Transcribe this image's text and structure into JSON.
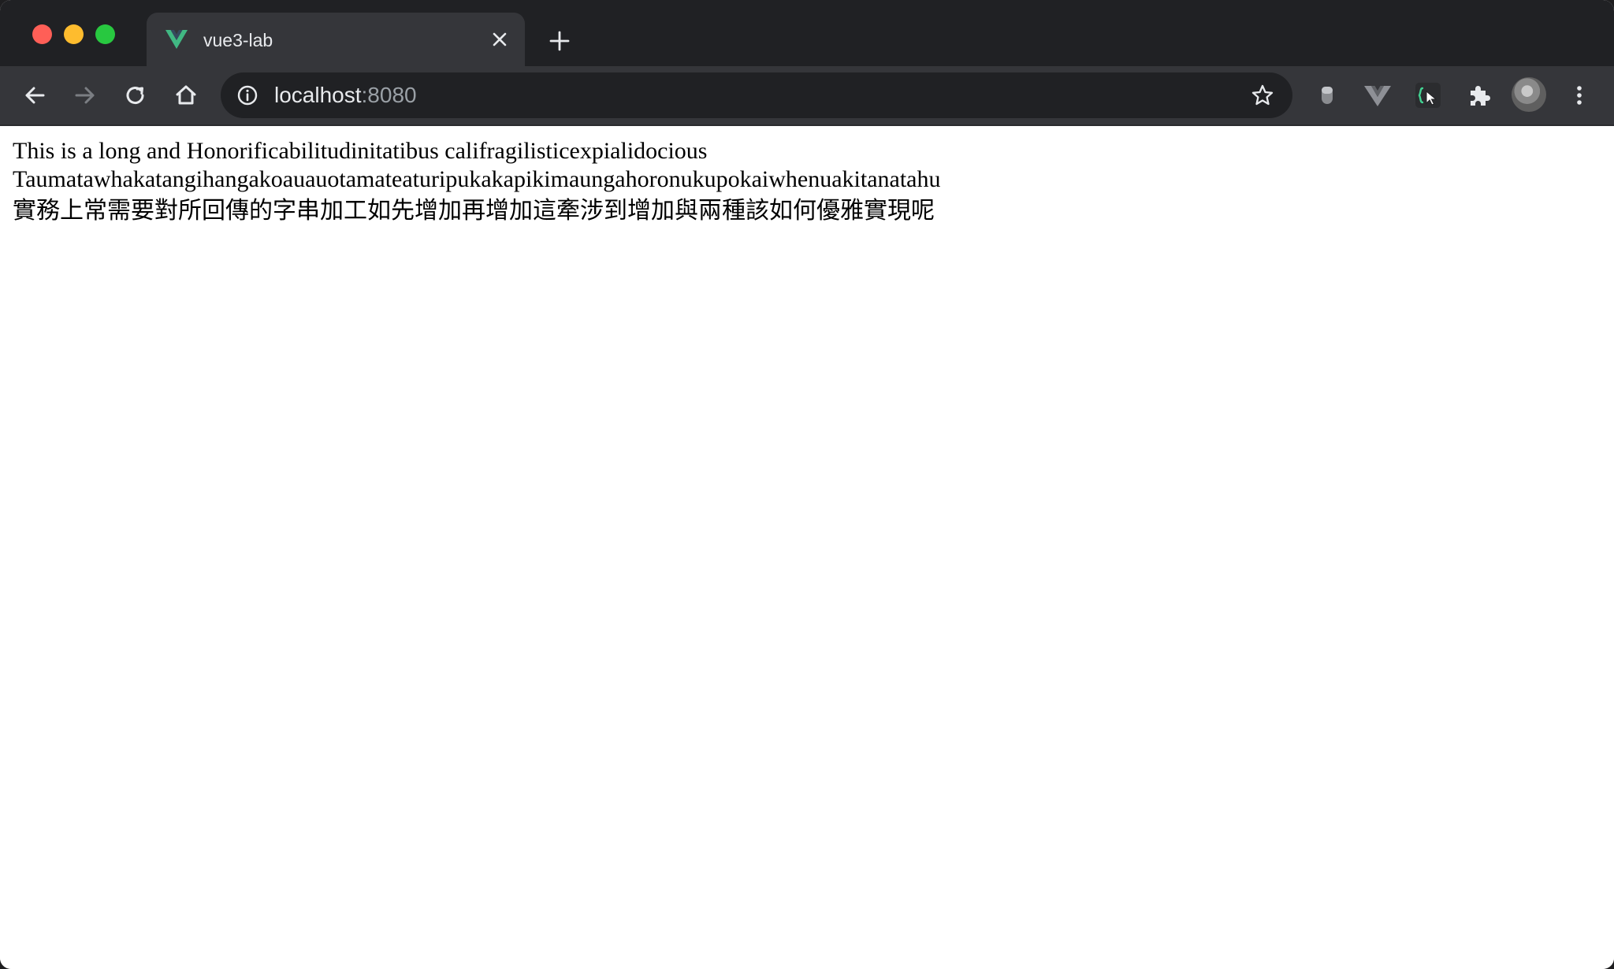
{
  "browser": {
    "tab": {
      "title": "vue3-lab",
      "favicon": "vue-logo-icon"
    },
    "address_bar": {
      "host": "localhost",
      "port": ":8080"
    },
    "colors": {
      "vue_green": "#41b883",
      "close_red": "#ff5f57",
      "minimize_yellow": "#febc2e",
      "zoom_green": "#28c840"
    }
  },
  "page": {
    "lines": [
      "This is a long and Honorificabilitudinitatibus califragilisticexpialidocious",
      "Taumatawhakatangihangakoauauotamateaturipukakapikimaungahoronukupokaiwhenuakitanatahu",
      "實務上常需要對所回傳的字串加工如先增加再增加這牽涉到增加與兩種該如何優雅實現呢"
    ]
  }
}
